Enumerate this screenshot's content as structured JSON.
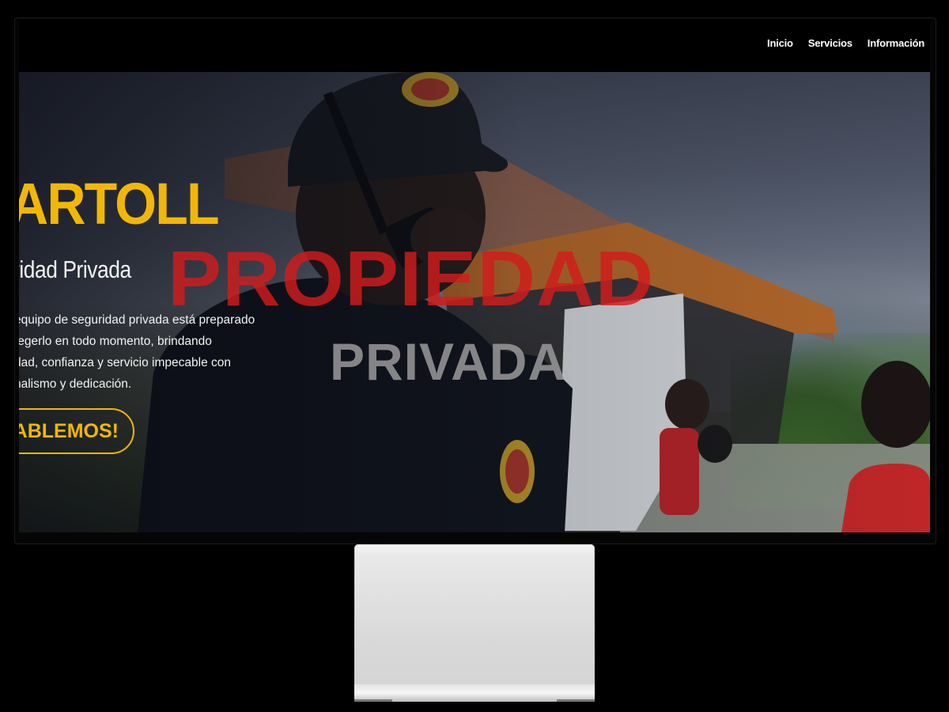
{
  "nav": {
    "links": [
      "Inicio",
      "Servicios",
      "Información"
    ]
  },
  "hero": {
    "brand": "ARTOLL",
    "subtitle": "ridad Privada",
    "description": [
      "equipo de seguridad privada está preparado",
      "tegerlo en todo momento, brindando",
      "dad, confianza y servicio impecable con",
      "nalismo y dedicación."
    ],
    "cta_label": "ABLEMOS!",
    "overlay_word_1": "PROPIEDAD",
    "overlay_word_2": "PRIVADA"
  },
  "colors": {
    "accent": "#f2b705",
    "overlay_red": "#d21c1c",
    "background": "#000000"
  }
}
